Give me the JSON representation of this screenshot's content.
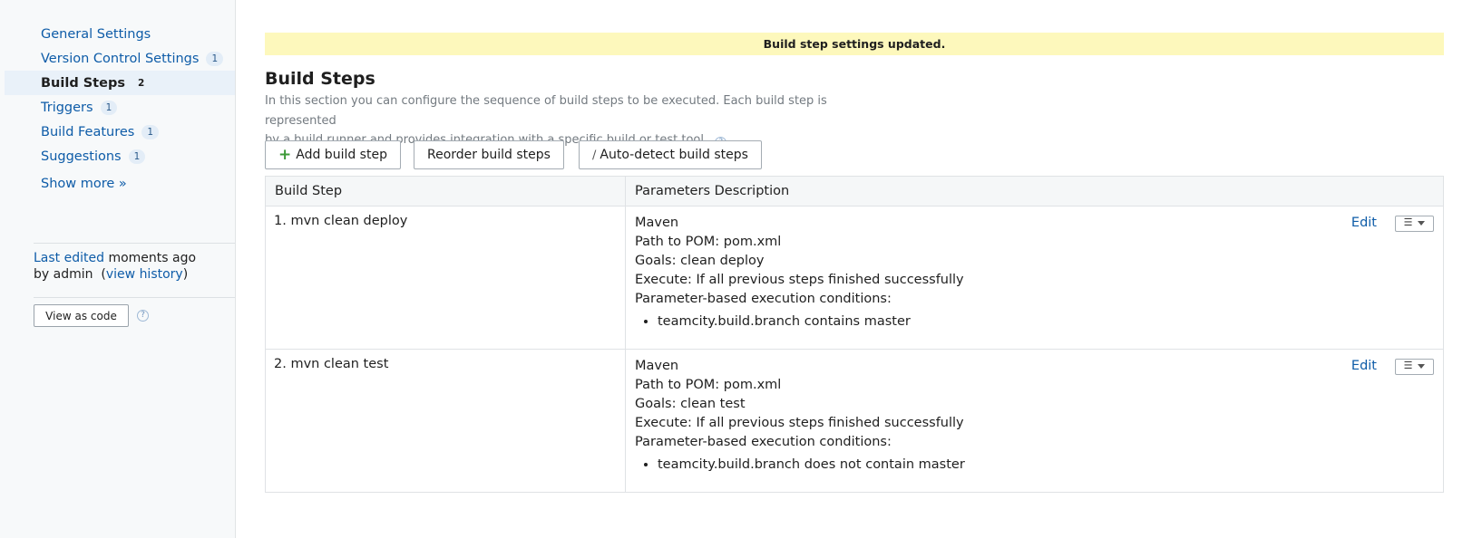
{
  "sidebar": {
    "items": [
      {
        "label": "General Settings",
        "count": ""
      },
      {
        "label": "Version Control Settings",
        "count": "1"
      },
      {
        "label": "Build Steps",
        "count": "2"
      },
      {
        "label": "Triggers",
        "count": "1"
      },
      {
        "label": "Build Features",
        "count": "1"
      },
      {
        "label": "Suggestions",
        "count": "1"
      }
    ],
    "active_item": "Build Steps",
    "show_more": "Show more »",
    "last_edited_link": "Last edited",
    "last_edited_when": "moments ago",
    "last_edited_by": "by admin",
    "view_history": "view history",
    "view_as_code": "View as code",
    "help_glyph": "?"
  },
  "notice": "Build step settings updated.",
  "main": {
    "title": "Build Steps",
    "description_line1": "In this section you can configure the sequence of build steps to be executed. Each build step is represented",
    "description_line2": "by a build runner and provides integration with a specific build or test tool.",
    "buttons": {
      "add": "Add build step",
      "reorder": "Reorder build steps",
      "autodetect": "Auto-detect build steps"
    },
    "table": {
      "headers": [
        "Build Step",
        "Parameters Description"
      ],
      "edit_label": "Edit",
      "rows": [
        {
          "name": "1. mvn clean deploy",
          "runner": "Maven",
          "pom": "Path to POM: pom.xml",
          "goals": "Goals: clean deploy",
          "execute": "Execute: If all previous steps finished successfully",
          "conditions_label": "Parameter-based execution conditions:",
          "condition": "teamcity.build.branch contains master"
        },
        {
          "name": "2. mvn clean test",
          "runner": "Maven",
          "pom": "Path to POM: pom.xml",
          "goals": "Goals: clean test",
          "execute": "Execute: If all previous steps finished successfully",
          "conditions_label": "Parameter-based execution conditions:",
          "condition": "teamcity.build.branch does not contain master"
        }
      ]
    }
  },
  "icons": {
    "plus": "plus-icon",
    "wand": "magic-wand-icon",
    "list": "list-icon",
    "dropdown": "chevron-down-icon",
    "help": "help-icon"
  }
}
